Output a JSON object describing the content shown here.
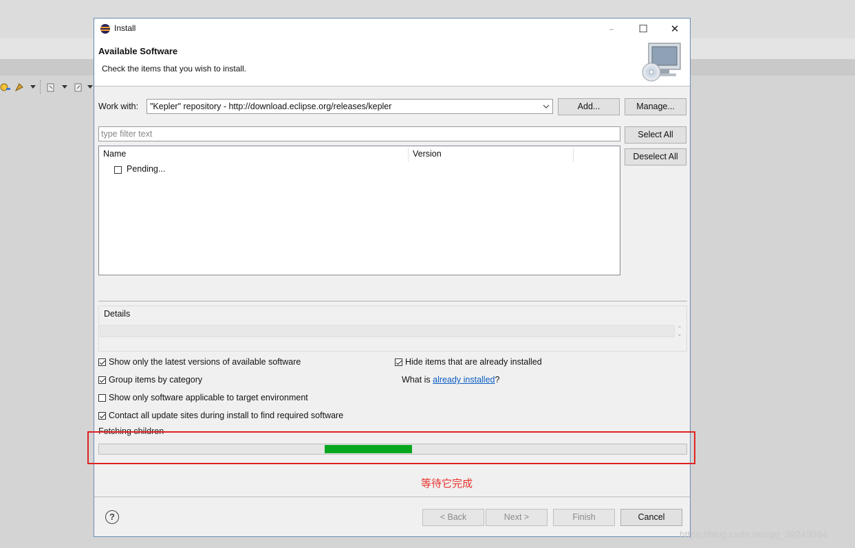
{
  "window": {
    "title": "Install",
    "minimize_glyph": "–",
    "maximize_glyph": "☐",
    "close_glyph": "✕"
  },
  "banner": {
    "title": "Available Software",
    "subtitle": "Check the items that you wish to install."
  },
  "work_with": {
    "label": "Work with:",
    "value": "\"Kepler\" repository - http://download.eclipse.org/releases/kepler",
    "add_label": "Add...",
    "manage_label": "Manage..."
  },
  "filter": {
    "placeholder": "type filter text"
  },
  "table": {
    "columns": [
      "Name",
      "Version"
    ],
    "rows": [
      {
        "name": "Pending...",
        "checked": false
      }
    ]
  },
  "side_buttons": {
    "select_all": "Select All",
    "deselect_all": "Deselect All"
  },
  "details": {
    "label": "Details"
  },
  "options": {
    "latest_versions": {
      "label": "Show only the latest versions of available software",
      "checked": true
    },
    "group_by_category": {
      "label": "Group items by category",
      "checked": true
    },
    "target_env": {
      "label": "Show only software applicable to target environment",
      "checked": false
    },
    "contact_sites": {
      "label": "Contact all update sites during install to find required software",
      "checked": true
    },
    "hide_installed": {
      "label": "Hide items that are already installed",
      "checked": true
    }
  },
  "installed_info": {
    "prefix": "What is ",
    "link": "already installed",
    "suffix": "?"
  },
  "progress": {
    "status": "Fetching children",
    "fill_color": "#06a71f"
  },
  "footer": {
    "help_glyph": "?",
    "back": "< Back",
    "next": "Next >",
    "finish": "Finish",
    "cancel": "Cancel"
  },
  "annotation": {
    "text": "等待它完成",
    "color": "#e8302a"
  },
  "watermark": "https://blog.csdn.net/qq_39249094",
  "icons": [
    "eclipse-logo-icon",
    "install-computer-icon",
    "dropdown-arrow-icon",
    "help-icon",
    "checkbox-icon"
  ]
}
